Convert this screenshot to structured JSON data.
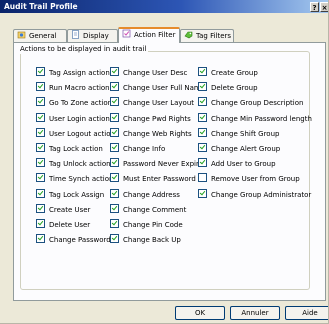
{
  "window": {
    "title": "Audit Trail Profile",
    "title_buttons": [
      "?",
      "×"
    ]
  },
  "tabs": [
    {
      "label": "General",
      "icon": "general-icon"
    },
    {
      "label": "Display",
      "icon": "display-icon"
    },
    {
      "label": "Action Filter",
      "icon": "action-filter-icon",
      "active": true
    },
    {
      "label": "Tag Filters",
      "icon": "tag-filters-icon"
    }
  ],
  "group_label": "Actions to be displayed in audit trail",
  "columns": [
    [
      {
        "label": "Tag Assign action",
        "checked": true
      },
      {
        "label": "Run Macro action",
        "checked": true
      },
      {
        "label": "Go To Zone action",
        "checked": true
      },
      {
        "label": "User Login action",
        "checked": true
      },
      {
        "label": "User Logout action",
        "checked": true
      },
      {
        "label": "Tag Lock action",
        "checked": true
      },
      {
        "label": "Tag Unlock action",
        "checked": true
      },
      {
        "label": "Time Synch action",
        "checked": true
      },
      {
        "label": "Tag Lock Assign",
        "checked": true
      },
      {
        "label": "Create User",
        "checked": true
      },
      {
        "label": "Delete User",
        "checked": true
      },
      {
        "label": "Change Password",
        "checked": true
      }
    ],
    [
      {
        "label": "Change User Desc",
        "checked": true
      },
      {
        "label": "Change User Full Name",
        "checked": true
      },
      {
        "label": "Change User Layout",
        "checked": true
      },
      {
        "label": "Change Pwd Rights",
        "checked": true
      },
      {
        "label": "Change Web Rights",
        "checked": true
      },
      {
        "label": "Change Info",
        "checked": true
      },
      {
        "label": "Password Never Expire",
        "checked": true
      },
      {
        "label": "Must Enter Password",
        "checked": true
      },
      {
        "label": "Change Address",
        "checked": true
      },
      {
        "label": "Change Comment",
        "checked": true
      },
      {
        "label": "Change Pin Code",
        "checked": true
      },
      {
        "label": "Change Back Up",
        "checked": true
      }
    ],
    [
      {
        "label": "Create Group",
        "checked": true
      },
      {
        "label": "Delete Group",
        "checked": true
      },
      {
        "label": "Change Group Description",
        "checked": true
      },
      {
        "label": "Change Min Password length",
        "checked": true
      },
      {
        "label": "Change Shift Group",
        "checked": true
      },
      {
        "label": "Change Alert Group",
        "checked": true
      },
      {
        "label": "Add User to Group",
        "checked": true
      },
      {
        "label": "Remove User from Group",
        "checked": false
      },
      {
        "label": "Change Group Administrator",
        "checked": true
      }
    ]
  ],
  "buttons": {
    "ok": "OK",
    "cancel": "Annuler",
    "help": "Aide"
  },
  "colors": {
    "titlebar_start": "#0a246a",
    "titlebar_end": "#a6caf0",
    "tab_accent": "#e68b2c",
    "check": "#21a121"
  }
}
